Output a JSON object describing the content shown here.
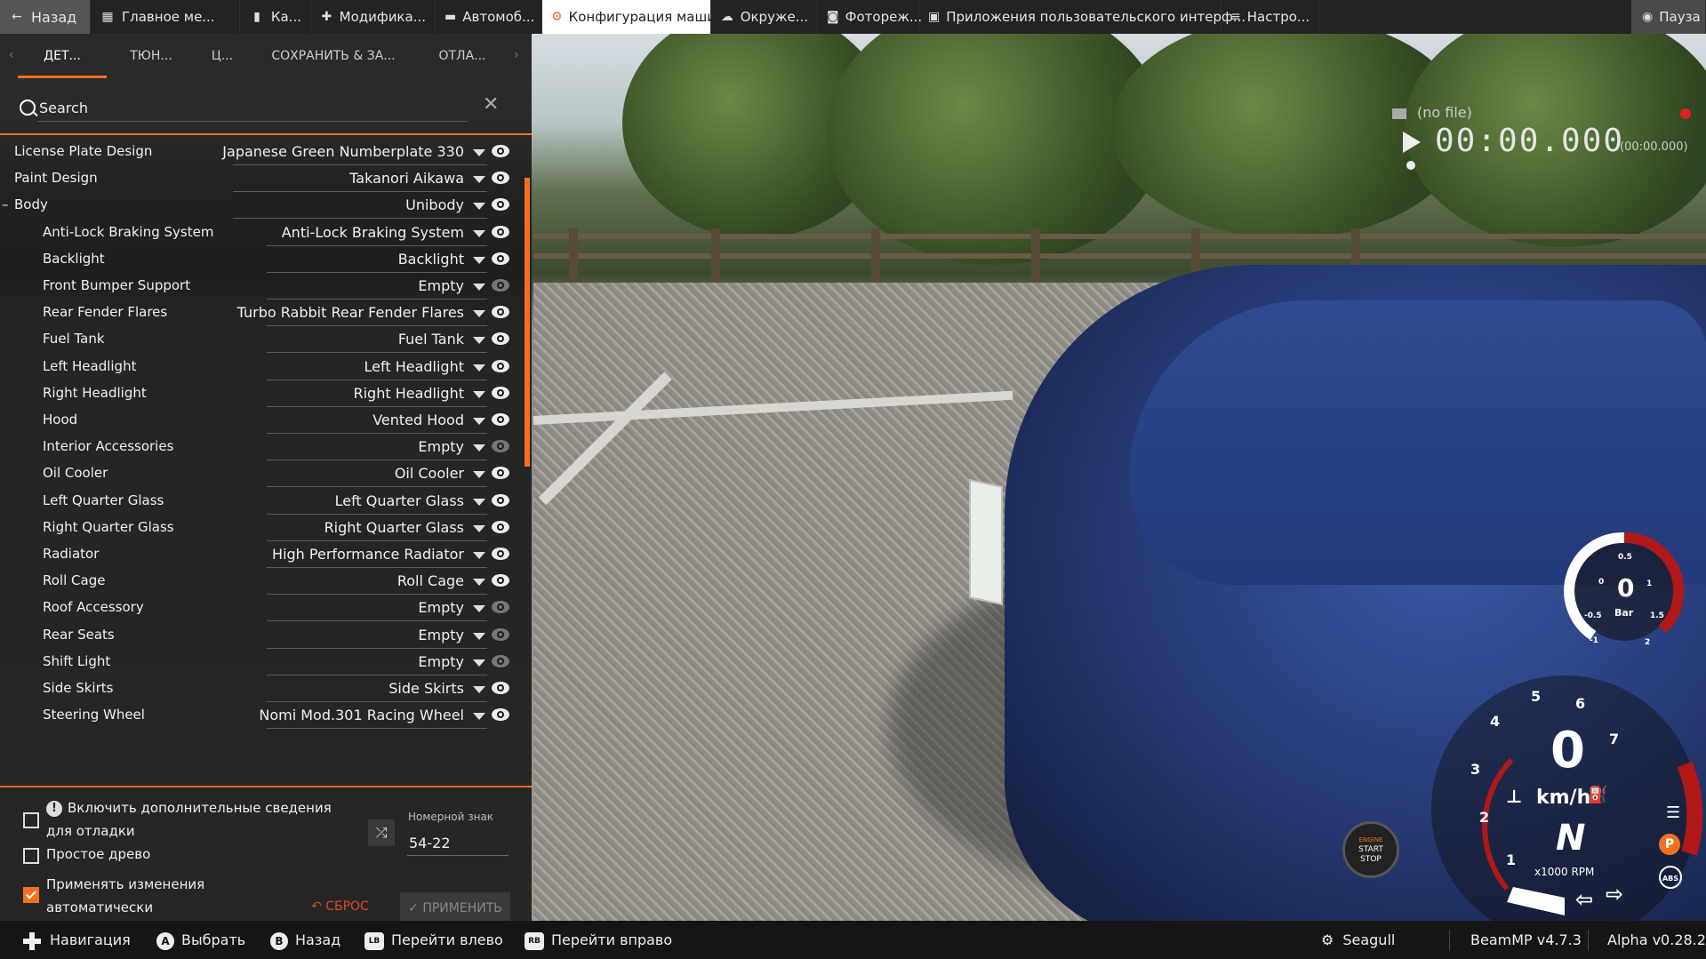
{
  "topbar": {
    "back_label": "Назад",
    "tabs": [
      {
        "label": "Главное ме...",
        "icon": "grid-icon"
      },
      {
        "label": "Ка...",
        "icon": "map-icon"
      },
      {
        "label": "Модифика...",
        "icon": "puzzle-icon"
      },
      {
        "label": "Автомоб...",
        "icon": "car-icon"
      },
      {
        "label": "Конфигурация машины",
        "icon": "engine-icon",
        "active": true
      },
      {
        "label": "Окруже...",
        "icon": "weather-icon"
      },
      {
        "label": "Фотореж...",
        "icon": "camera-icon"
      },
      {
        "label": "Приложения пользовательского интерф...",
        "icon": "apps-icon"
      },
      {
        "label": "Настро...",
        "icon": "sliders-icon"
      }
    ],
    "pause_label": "Пауза"
  },
  "panel": {
    "subtabs": [
      "ДЕТ...",
      "ТЮН...",
      "Ц...",
      "СОХРАНИТЬ & ЗА...",
      "ОТЛА..."
    ],
    "search_placeholder": "Search",
    "parts": [
      {
        "slot": "License Plate Design",
        "value": "Japanese Green Numberplate 330",
        "level": 0,
        "eye": "on"
      },
      {
        "slot": "Paint Design",
        "value": "Takanori Aikawa",
        "level": 0,
        "eye": "on"
      },
      {
        "slot": "Body",
        "value": "Unibody",
        "level": 0,
        "collapse": "–",
        "eye": "on"
      },
      {
        "slot": "Anti-Lock Braking System",
        "value": "Anti-Lock Braking System",
        "level": 1,
        "eye": "on"
      },
      {
        "slot": "Backlight",
        "value": "Backlight",
        "level": 1,
        "eye": "on"
      },
      {
        "slot": "Front Bumper Support",
        "value": "Empty",
        "level": 1,
        "eye": "dim"
      },
      {
        "slot": "Rear Fender Flares",
        "value": "Turbo Rabbit Rear Fender Flares",
        "level": 1,
        "eye": "on"
      },
      {
        "slot": "Fuel Tank",
        "value": "Fuel Tank",
        "level": 1,
        "eye": "on"
      },
      {
        "slot": "Left Headlight",
        "value": "Left Headlight",
        "level": 1,
        "eye": "on"
      },
      {
        "slot": "Right Headlight",
        "value": "Right Headlight",
        "level": 1,
        "eye": "on"
      },
      {
        "slot": "Hood",
        "value": "Vented Hood",
        "level": 1,
        "eye": "on"
      },
      {
        "slot": "Interior Accessories",
        "value": "Empty",
        "level": 1,
        "eye": "dim"
      },
      {
        "slot": "Oil Cooler",
        "value": "Oil Cooler",
        "level": 1,
        "eye": "on"
      },
      {
        "slot": "Left Quarter Glass",
        "value": "Left Quarter Glass",
        "level": 1,
        "eye": "on"
      },
      {
        "slot": "Right Quarter Glass",
        "value": "Right Quarter Glass",
        "level": 1,
        "eye": "on"
      },
      {
        "slot": "Radiator",
        "value": "High Performance Radiator",
        "level": 1,
        "eye": "on"
      },
      {
        "slot": "Roll Cage",
        "value": "Roll Cage",
        "level": 1,
        "eye": "on"
      },
      {
        "slot": "Roof Accessory",
        "value": "Empty",
        "level": 1,
        "eye": "dim"
      },
      {
        "slot": "Rear Seats",
        "value": "Empty",
        "level": 1,
        "eye": "dim"
      },
      {
        "slot": "Shift Light",
        "value": "Empty",
        "level": 1,
        "eye": "dim"
      },
      {
        "slot": "Side Skirts",
        "value": "Side Skirts",
        "level": 1,
        "eye": "on"
      },
      {
        "slot": "Steering Wheel",
        "value": "Nomi Mod.301 Racing Wheel",
        "level": 1,
        "eye": "on"
      }
    ],
    "options": {
      "debug_label_1": "Включить дополнительные сведения",
      "debug_label_2": "для отладки",
      "debug_checked": false,
      "simple_tree_label": "Простое древо",
      "simple_tree_checked": false,
      "autoapply_label_1": "Применять изменения",
      "autoapply_label_2": "автоматически",
      "autoapply_checked": true,
      "plate_label": "Номерной знак",
      "plate_value": "54-22",
      "reset_label": "СБРОС",
      "apply_label": "ПРИМЕНИТЬ"
    }
  },
  "recorder": {
    "file": "(no file)",
    "time": "00:00.000",
    "sub": "(00:00.000)"
  },
  "gauges": {
    "boost_value": "0",
    "boost_unit": "Bar",
    "boost_ticks": [
      "0",
      "0.5",
      "1",
      "1.5",
      "2",
      "-0.5",
      "-1"
    ],
    "speed": "0",
    "speed_unit": "km/h",
    "gear": "N",
    "rpm_unit": "x1000 RPM",
    "rpm_ticks": [
      "1",
      "2",
      "3",
      "4",
      "5",
      "6",
      "7"
    ],
    "engine_btn": [
      "ENGINE",
      "START",
      "STOP"
    ]
  },
  "bottombar": {
    "nav": "Навигация",
    "select": "Выбрать",
    "back": "Назад",
    "left": "Перейти влево",
    "right": "Перейти вправо",
    "btn_a": "A",
    "btn_b": "B",
    "btn_lb": "LB",
    "btn_rb": "RB",
    "user": "Seagull",
    "mp_version": "BeamMP v4.7.3",
    "game_version": "Alpha v0.28.2"
  },
  "colors": {
    "accent": "#f37021",
    "panel_bg": "#1c1c1c"
  }
}
